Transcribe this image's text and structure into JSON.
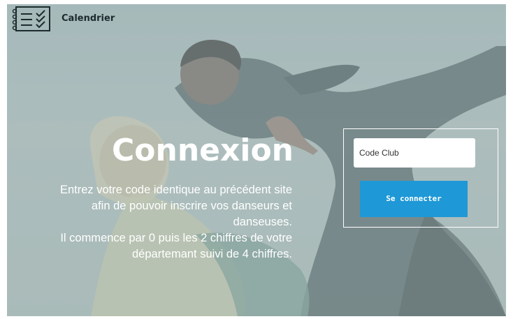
{
  "header": {
    "brand": "Calendrier",
    "logo_icon": "calendar-checklist-icon"
  },
  "hero": {
    "title": "Connexion",
    "description_lines": [
      "Entrez votre code identique au précédent site",
      "afin de pouvoir inscrire vos danseurs et",
      "danseuses.",
      "Il commence par 0 puis les 2 chiffres de votre",
      "départemant suivi de 4 chiffres."
    ]
  },
  "login": {
    "code_placeholder": "Code Club",
    "code_value": "",
    "button_label": "Se connecter",
    "button_color": "#1e98d6"
  },
  "colors": {
    "overlay": "#afc3c4",
    "text": "#ffffff"
  }
}
